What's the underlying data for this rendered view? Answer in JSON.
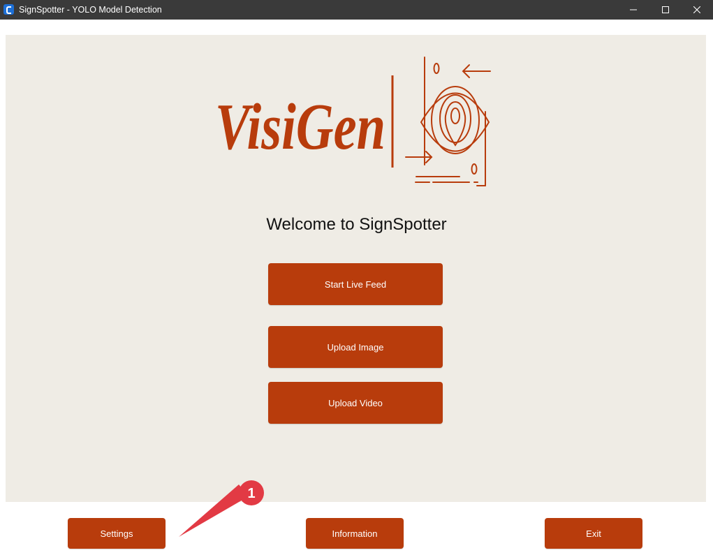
{
  "window": {
    "title": "SignSpotter - YOLO Model Detection",
    "icon": "app-icon"
  },
  "window_controls": [
    "minimize-icon",
    "maximize-icon",
    "close-icon"
  ],
  "logo": {
    "text": "VisiGen",
    "color": "#b83c0c",
    "icon": "eye-location-icon"
  },
  "welcome": {
    "text": "Welcome to SignSpotter"
  },
  "main_buttons": {
    "live_feed": "Start Live Feed",
    "upload_image": "Upload Image",
    "upload_video": "Upload Video"
  },
  "bottom_buttons": {
    "settings": "Settings",
    "information": "Information",
    "exit": "Exit"
  },
  "annotation": {
    "number": "1",
    "color": "#e23a44"
  },
  "colors": {
    "accent": "#b83c0c",
    "panel_background": "#efece5",
    "titlebar": "#3a3a3a"
  }
}
